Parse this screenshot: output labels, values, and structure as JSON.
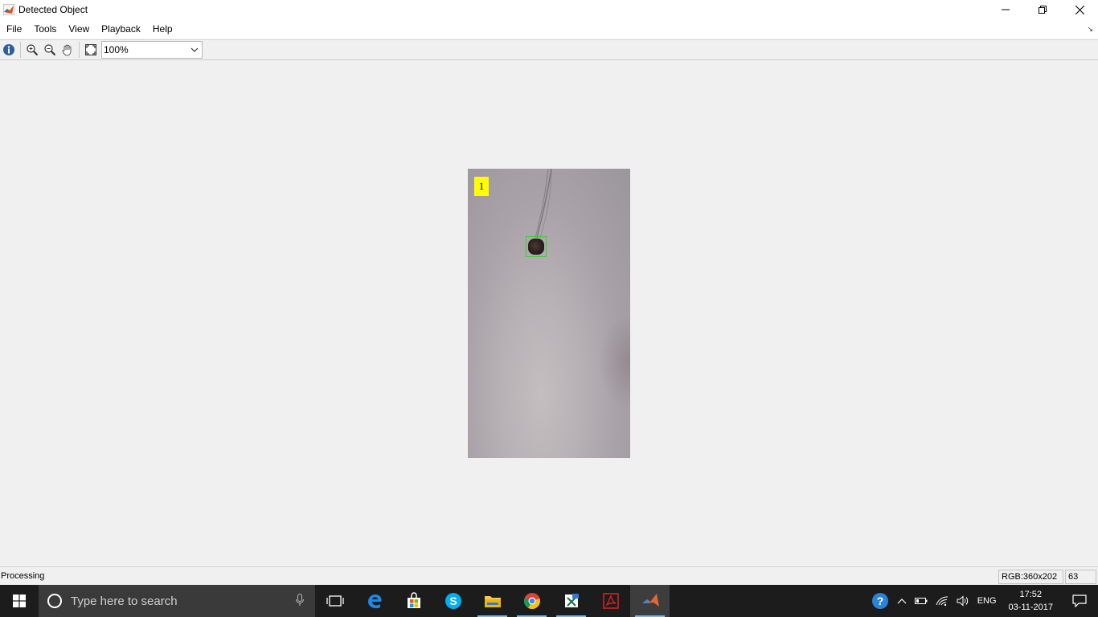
{
  "window": {
    "title": "Detected Object"
  },
  "menu": {
    "items": [
      "File",
      "Tools",
      "View",
      "Playback",
      "Help"
    ]
  },
  "toolbar": {
    "zoom_value": "100%"
  },
  "frame": {
    "label": "1"
  },
  "status": {
    "text": "Processing",
    "format": "RGB:360x202",
    "frame_number": "63"
  },
  "taskbar": {
    "search_placeholder": "Type here to search",
    "apps": [
      "task-view",
      "edge",
      "store",
      "skype",
      "file-explorer",
      "chrome",
      "excel",
      "acrobat",
      "matlab"
    ],
    "language": "ENG",
    "time": "17:52",
    "date": "03-11-2017"
  },
  "colors": {
    "bbox": "#2fd32f",
    "label_bg": "#ffff00",
    "taskbar": "#1c1c1c",
    "accent": "#76b9ed"
  }
}
